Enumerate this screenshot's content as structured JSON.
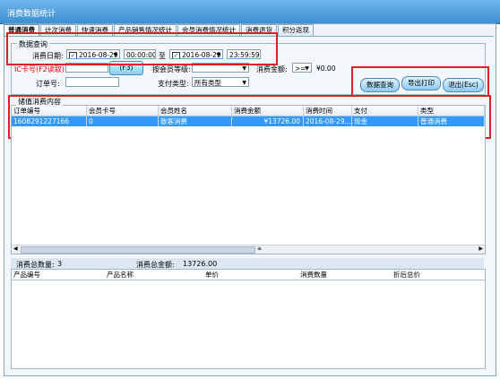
{
  "window": {
    "title": "消费数据统计"
  },
  "tabs": [
    {
      "label": "普通消费",
      "active": true
    },
    {
      "label": "计次消费"
    },
    {
      "label": "快速消费"
    },
    {
      "label": "产品销售情况统计"
    },
    {
      "label": "会员消费情况统计"
    },
    {
      "label": "消费退货"
    },
    {
      "label": "积分返现"
    }
  ],
  "query": {
    "group_title": "数据查询",
    "date_label": "消费日期:",
    "start_date": "2016-08-29",
    "start_time": "00:00:00",
    "to_label": "至",
    "end_date": "2016-08-29",
    "end_time": "23:59:59",
    "card_label": "IC卡号(F2读取)",
    "card_btn": "(F3)",
    "level_label": "按会员等级:",
    "level_value": "",
    "amount_label": "消费金额:",
    "amount_op": ">=",
    "amount_value": "¥0.00",
    "order_label": "订单号:",
    "order_value": "",
    "pay_label": "支付类型:",
    "pay_value": "所有类型"
  },
  "buttons": {
    "query": "数据查询",
    "export": "导出打印",
    "exit": "退出(Esc)"
  },
  "records": {
    "group_title": "储值消费内容",
    "columns": [
      "订单编号",
      "会员卡号",
      "会员姓名",
      "消费金额",
      "消费时间",
      "支付",
      "类型"
    ],
    "rows": [
      {
        "order": "160829122716​6",
        "card": "0",
        "name": "散客消费",
        "amount": "¥13726.00",
        "time": "2016-08-29...",
        "pay": "现金",
        "type": "普通消费"
      }
    ]
  },
  "summary": {
    "count_label": "消费总数量:",
    "count": "3",
    "total_label": "消费总金额:",
    "total": "13726.00"
  },
  "detail": {
    "columns": [
      "产品编号",
      "产品名称",
      "单价",
      "消费数量",
      "折后总价"
    ]
  },
  "colors": {
    "highlight": "#3399ff",
    "annotation": "#e02020",
    "title_bar": "#3f8fd2"
  }
}
